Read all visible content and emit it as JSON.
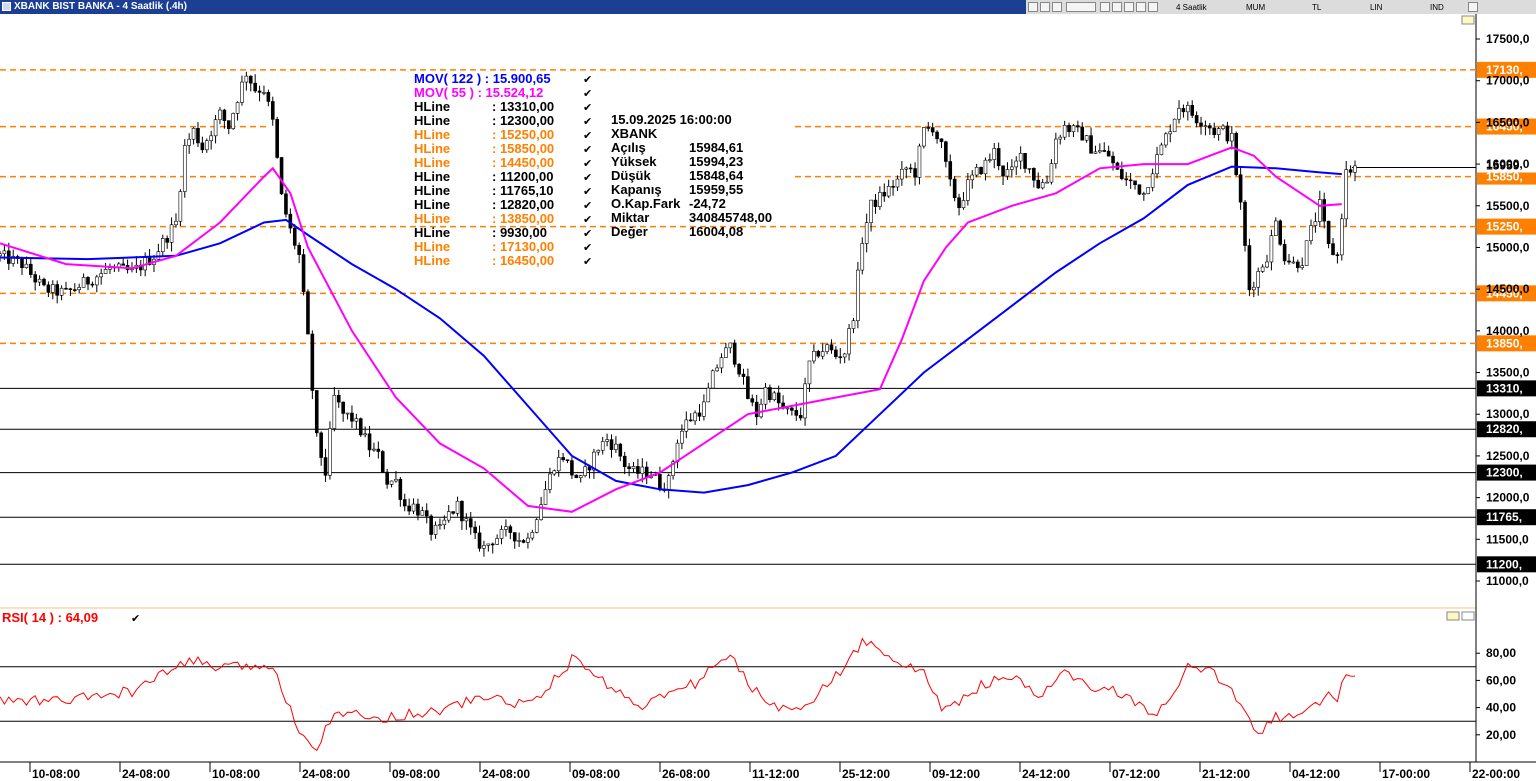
{
  "window": {
    "title": "XBANK BIST BANKA - 4 Saatlik (.4h)"
  },
  "toolbar": {
    "period": "4 Saatlik",
    "chart_style": "MUM",
    "currency": "TL",
    "scale": "LIN",
    "mode": "IND"
  },
  "legend": {
    "mov122": "MOV( 122 ) : 15.900,65",
    "mov55": "MOV( 55 )   : 15.524,12",
    "hlines": [
      {
        "label": "HLine",
        "value": ": 13310,00",
        "color": "#000000"
      },
      {
        "label": "HLine",
        "value": ": 12300,00",
        "color": "#000000"
      },
      {
        "label": "HLine",
        "value": ": 15250,00",
        "color": "#ff8000"
      },
      {
        "label": "HLine",
        "value": ": 15850,00",
        "color": "#ff8000"
      },
      {
        "label": "HLine",
        "value": ": 14450,00",
        "color": "#ff8000"
      },
      {
        "label": "HLine",
        "value": ": 11200,00",
        "color": "#000000"
      },
      {
        "label": "HLine",
        "value": ": 11765,10",
        "color": "#000000"
      },
      {
        "label": "HLine",
        "value": ": 12820,00",
        "color": "#000000"
      },
      {
        "label": "HLine",
        "value": ": 13850,00",
        "color": "#ff8000"
      },
      {
        "label": "HLine",
        "value": ": 9930,00",
        "color": "#000000"
      },
      {
        "label": "HLine",
        "value": ": 17130,00",
        "color": "#ff8000"
      },
      {
        "label": "HLine",
        "value": ": 16450,00",
        "color": "#ff8000"
      }
    ],
    "check_glyph": "✔"
  },
  "info": {
    "datetime": "15.09.2025  16:00:00",
    "symbol": "XBANK",
    "rows": [
      {
        "k": "Açılış",
        "v": "15984,61"
      },
      {
        "k": "Yüksek",
        "v": "15994,23"
      },
      {
        "k": "Düşük",
        "v": "15848,64"
      },
      {
        "k": "Kapanış",
        "v": "15959,55"
      },
      {
        "k": "O.Kap.Fark",
        "v": "-24,72"
      },
      {
        "k": "Miktar",
        "v": "340845748,00"
      },
      {
        "k": "Değer",
        "v": "16004,08"
      }
    ]
  },
  "rsi_legend": "RSI( 14 )   : 64,09",
  "chart_data": {
    "type": "candlestick",
    "symbol": "XBANK",
    "ylim": [
      10700,
      17800
    ],
    "yticks": [
      "17500,0",
      "17000,0",
      "16500,0",
      "16000,0",
      "15500,0",
      "15000,0",
      "14500,0",
      "14000,0",
      "13500,0",
      "13000,0",
      "12500,0",
      "12000,0",
      "11500,0",
      "11000,0"
    ],
    "ytick_values": [
      17500,
      17000,
      16500,
      16000,
      15500,
      15000,
      14500,
      14000,
      13500,
      13000,
      12500,
      12000,
      11500,
      11000
    ],
    "xticks": [
      "10-08:00",
      "24-08:00",
      "10-08:00",
      "24-08:00",
      "09-08:00",
      "24-08:00",
      "09-08:00",
      "26-08:00",
      "11-12:00",
      "25-12:00",
      "09-12:00",
      "24-12:00",
      "07-12:00",
      "21-12:00",
      "04-12:00",
      "17-00:00",
      "22-00:00"
    ],
    "last_price_label": "15959",
    "last_price": 15959,
    "hlines": [
      {
        "value": 17130,
        "label": "17130,",
        "style": "dashed",
        "color": "#ff8000"
      },
      {
        "value": 16450,
        "label": "16450,",
        "style": "dashed",
        "color": "#ff8000"
      },
      {
        "value": 15850,
        "label": "15850,",
        "style": "dashed",
        "color": "#ff8000"
      },
      {
        "value": 15250,
        "label": "15250,",
        "style": "dashed",
        "color": "#ff8000"
      },
      {
        "value": 14450,
        "label": "14450,",
        "style": "dashed",
        "color": "#ff8000"
      },
      {
        "value": 13850,
        "label": "13850,",
        "style": "dashed",
        "color": "#ff8000"
      },
      {
        "value": 13310,
        "label": "13310,",
        "style": "solid",
        "color": "#000000"
      },
      {
        "value": 12820,
        "label": "12820,",
        "style": "solid",
        "color": "#000000"
      },
      {
        "value": 12300,
        "label": "12300,",
        "style": "solid",
        "color": "#000000"
      },
      {
        "value": 11765,
        "label": "11765,",
        "style": "solid",
        "color": "#000000"
      },
      {
        "value": 11200,
        "label": "11200,",
        "style": "solid",
        "color": "#000000"
      }
    ],
    "price_path": [
      [
        0,
        14900
      ],
      [
        5,
        14800
      ],
      [
        10,
        14500
      ],
      [
        15,
        14450
      ],
      [
        20,
        14600
      ],
      [
        25,
        14750
      ],
      [
        30,
        14700
      ],
      [
        35,
        14900
      ],
      [
        40,
        15300
      ],
      [
        42,
        16200
      ],
      [
        44,
        16400
      ],
      [
        46,
        16200
      ],
      [
        48,
        16400
      ],
      [
        50,
        16600
      ],
      [
        52,
        16450
      ],
      [
        54,
        16800
      ],
      [
        56,
        17100
      ],
      [
        58,
        16900
      ],
      [
        60,
        16900
      ],
      [
        62,
        16500
      ],
      [
        64,
        15600
      ],
      [
        66,
        15200
      ],
      [
        68,
        14900
      ],
      [
        70,
        13900
      ],
      [
        72,
        12700
      ],
      [
        74,
        12300
      ],
      [
        76,
        13200
      ],
      [
        78,
        13000
      ],
      [
        80,
        12950
      ],
      [
        82,
        12800
      ],
      [
        84,
        12600
      ],
      [
        86,
        12500
      ],
      [
        88,
        12200
      ],
      [
        90,
        12200
      ],
      [
        92,
        11900
      ],
      [
        94,
        11900
      ],
      [
        96,
        11800
      ],
      [
        98,
        11600
      ],
      [
        100,
        11600
      ],
      [
        102,
        11800
      ],
      [
        104,
        11900
      ],
      [
        106,
        11700
      ],
      [
        108,
        11500
      ],
      [
        110,
        11400
      ],
      [
        112,
        11500
      ],
      [
        114,
        11550
      ],
      [
        116,
        11600
      ],
      [
        118,
        11500
      ],
      [
        120,
        11500
      ],
      [
        122,
        11800
      ],
      [
        124,
        12100
      ],
      [
        126,
        12400
      ],
      [
        128,
        12500
      ],
      [
        130,
        12300
      ],
      [
        132,
        12200
      ],
      [
        134,
        12400
      ],
      [
        136,
        12600
      ],
      [
        138,
        12700
      ],
      [
        140,
        12600
      ],
      [
        142,
        12400
      ],
      [
        144,
        12300
      ],
      [
        146,
        12300
      ],
      [
        148,
        12300
      ],
      [
        150,
        12150
      ],
      [
        152,
        12200
      ],
      [
        154,
        12700
      ],
      [
        156,
        12900
      ],
      [
        158,
        13000
      ],
      [
        160,
        13100
      ],
      [
        162,
        13450
      ],
      [
        164,
        13700
      ],
      [
        166,
        13800
      ],
      [
        168,
        13550
      ],
      [
        170,
        13200
      ],
      [
        172,
        13000
      ],
      [
        174,
        13300
      ],
      [
        176,
        13200
      ],
      [
        178,
        13050
      ],
      [
        180,
        13000
      ],
      [
        182,
        13000
      ],
      [
        184,
        13600
      ],
      [
        186,
        13750
      ],
      [
        188,
        13800
      ],
      [
        190,
        13700
      ],
      [
        192,
        13750
      ],
      [
        194,
        14200
      ],
      [
        196,
        15100
      ],
      [
        198,
        15500
      ],
      [
        200,
        15600
      ],
      [
        202,
        15700
      ],
      [
        204,
        15800
      ],
      [
        206,
        15950
      ],
      [
        208,
        15900
      ],
      [
        210,
        16400
      ],
      [
        212,
        16450
      ],
      [
        214,
        16200
      ],
      [
        216,
        15750
      ],
      [
        218,
        15500
      ],
      [
        220,
        15750
      ],
      [
        222,
        15900
      ],
      [
        224,
        16000
      ],
      [
        226,
        16150
      ],
      [
        228,
        15900
      ],
      [
        230,
        15900
      ],
      [
        232,
        16100
      ],
      [
        234,
        15950
      ],
      [
        236,
        15750
      ],
      [
        238,
        15800
      ],
      [
        240,
        16300
      ],
      [
        242,
        16450
      ],
      [
        244,
        16400
      ],
      [
        246,
        16350
      ],
      [
        248,
        16200
      ],
      [
        250,
        16150
      ],
      [
        252,
        16100
      ],
      [
        254,
        15900
      ],
      [
        256,
        15800
      ],
      [
        258,
        15750
      ],
      [
        260,
        15650
      ],
      [
        262,
        15950
      ],
      [
        264,
        16200
      ],
      [
        266,
        16450
      ],
      [
        268,
        16700
      ],
      [
        270,
        16650
      ],
      [
        272,
        16550
      ],
      [
        274,
        16500
      ],
      [
        276,
        16400
      ],
      [
        278,
        16400
      ],
      [
        280,
        16300
      ],
      [
        282,
        15500
      ],
      [
        284,
        14500
      ],
      [
        286,
        14700
      ],
      [
        288,
        14900
      ],
      [
        290,
        15300
      ],
      [
        292,
        14900
      ],
      [
        294,
        14800
      ],
      [
        296,
        14850
      ],
      [
        298,
        15200
      ],
      [
        300,
        15500
      ],
      [
        302,
        15000
      ],
      [
        304,
        14900
      ],
      [
        306,
        15900
      ],
      [
        308,
        15960
      ]
    ],
    "series": [
      {
        "name": "MOV( 122 )",
        "color": "#0000ff",
        "values": [
          [
            0,
            14880
          ],
          [
            20,
            14860
          ],
          [
            40,
            14900
          ],
          [
            50,
            15050
          ],
          [
            60,
            15300
          ],
          [
            65,
            15330
          ],
          [
            70,
            15150
          ],
          [
            80,
            14800
          ],
          [
            90,
            14500
          ],
          [
            100,
            14150
          ],
          [
            110,
            13700
          ],
          [
            120,
            13100
          ],
          [
            130,
            12500
          ],
          [
            140,
            12200
          ],
          [
            150,
            12100
          ],
          [
            160,
            12060
          ],
          [
            170,
            12150
          ],
          [
            180,
            12300
          ],
          [
            190,
            12500
          ],
          [
            200,
            13000
          ],
          [
            210,
            13500
          ],
          [
            220,
            13900
          ],
          [
            230,
            14300
          ],
          [
            240,
            14700
          ],
          [
            250,
            15050
          ],
          [
            260,
            15350
          ],
          [
            270,
            15750
          ],
          [
            280,
            15970
          ],
          [
            290,
            15950
          ],
          [
            300,
            15900
          ],
          [
            305,
            15880
          ]
        ]
      },
      {
        "name": "MOV( 55 )",
        "color": "#ff00ff",
        "values": [
          [
            0,
            15050
          ],
          [
            15,
            14800
          ],
          [
            30,
            14750
          ],
          [
            40,
            14900
          ],
          [
            50,
            15300
          ],
          [
            60,
            15850
          ],
          [
            62,
            15950
          ],
          [
            66,
            15650
          ],
          [
            70,
            15000
          ],
          [
            80,
            14000
          ],
          [
            90,
            13200
          ],
          [
            100,
            12650
          ],
          [
            110,
            12350
          ],
          [
            120,
            11900
          ],
          [
            130,
            11830
          ],
          [
            140,
            12100
          ],
          [
            150,
            12300
          ],
          [
            160,
            12650
          ],
          [
            170,
            13000
          ],
          [
            180,
            13100
          ],
          [
            190,
            13200
          ],
          [
            200,
            13300
          ],
          [
            205,
            13900
          ],
          [
            210,
            14600
          ],
          [
            215,
            15000
          ],
          [
            220,
            15300
          ],
          [
            230,
            15500
          ],
          [
            240,
            15650
          ],
          [
            250,
            15950
          ],
          [
            260,
            16000
          ],
          [
            270,
            16000
          ],
          [
            280,
            16200
          ],
          [
            285,
            16100
          ],
          [
            290,
            15850
          ],
          [
            300,
            15500
          ],
          [
            305,
            15520
          ]
        ]
      },
      {
        "name": "RSI( 14 )",
        "color": "#ff0000",
        "ylim": [
          0,
          100
        ],
        "yticks": [
          "80,00",
          "60,00",
          "40,00",
          "20,00"
        ],
        "ytick_values": [
          80,
          60,
          40,
          20
        ],
        "levels": [
          70,
          30
        ],
        "values": [
          [
            0,
            45
          ],
          [
            15,
            45
          ],
          [
            30,
            52
          ],
          [
            35,
            60
          ],
          [
            40,
            70
          ],
          [
            45,
            75
          ],
          [
            50,
            68
          ],
          [
            55,
            70
          ],
          [
            60,
            72
          ],
          [
            62,
            68
          ],
          [
            66,
            40
          ],
          [
            68,
            25
          ],
          [
            70,
            15
          ],
          [
            72,
            12
          ],
          [
            76,
            38
          ],
          [
            84,
            32
          ],
          [
            90,
            34
          ],
          [
            100,
            38
          ],
          [
            110,
            48
          ],
          [
            120,
            42
          ],
          [
            126,
            60
          ],
          [
            130,
            75
          ],
          [
            134,
            68
          ],
          [
            140,
            52
          ],
          [
            146,
            42
          ],
          [
            152,
            50
          ],
          [
            158,
            58
          ],
          [
            162,
            70
          ],
          [
            166,
            78
          ],
          [
            170,
            58
          ],
          [
            176,
            40
          ],
          [
            182,
            42
          ],
          [
            186,
            50
          ],
          [
            192,
            70
          ],
          [
            196,
            88
          ],
          [
            198,
            86
          ],
          [
            202,
            80
          ],
          [
            206,
            70
          ],
          [
            210,
            65
          ],
          [
            214,
            40
          ],
          [
            218,
            45
          ],
          [
            224,
            58
          ],
          [
            230,
            62
          ],
          [
            236,
            48
          ],
          [
            242,
            65
          ],
          [
            248,
            55
          ],
          [
            256,
            50
          ],
          [
            262,
            32
          ],
          [
            266,
            45
          ],
          [
            270,
            70
          ],
          [
            276,
            65
          ],
          [
            282,
            45
          ],
          [
            286,
            22
          ],
          [
            290,
            33
          ],
          [
            296,
            35
          ],
          [
            300,
            42
          ],
          [
            302,
            50
          ],
          [
            304,
            48
          ],
          [
            306,
            65
          ],
          [
            308,
            64
          ]
        ]
      }
    ]
  }
}
